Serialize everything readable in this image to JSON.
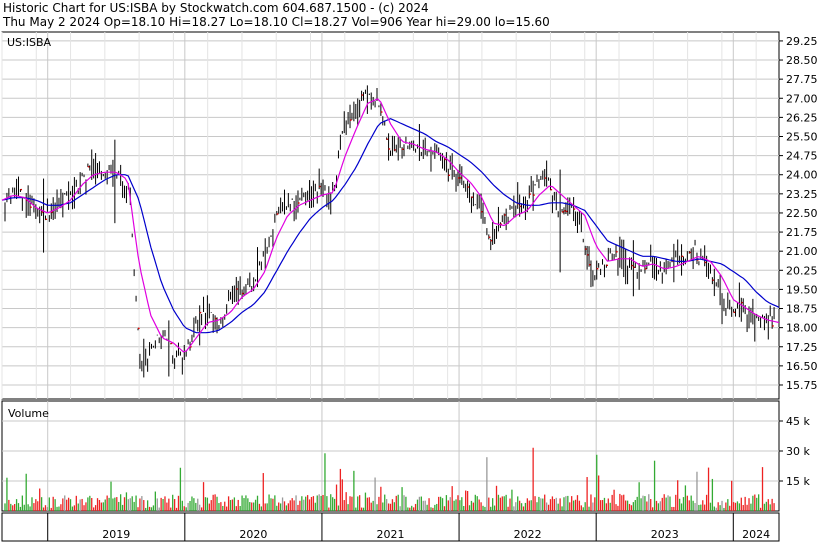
{
  "header": {
    "title_line": "Historic Chart for US:ISBA by Stockwatch.com 604.687.1500 - (c) 2024",
    "stats_line": "Thu May  2 2024  Op=18.10  Hi=18.27  Lo=18.10  Cl=18.27  Vol=906  Year hi=29.00  lo=15.60"
  },
  "colors": {
    "price_bar": "#000000",
    "down_tick": "#dd0000",
    "ma_short": "#e000e0",
    "ma_long": "#0000cc",
    "vol_up": "#33aa33",
    "vol_down": "#ee2222",
    "vol_neutral": "#999999",
    "grid": "#c8c8c8"
  },
  "chart_data": [
    {
      "type": "line",
      "symbol_label": "US:ISBA",
      "ylim": [
        15.2,
        29.6
      ],
      "y_ticks": [
        "29.25",
        "28.50",
        "27.75",
        "27.00",
        "26.25",
        "25.50",
        "24.75",
        "24.00",
        "23.25",
        "22.50",
        "21.75",
        "21.00",
        "20.25",
        "19.50",
        "18.75",
        "18.00",
        "17.25",
        "16.50",
        "15.75"
      ],
      "x_ticks": [
        "2019",
        "2020",
        "2021",
        "2022",
        "2023",
        "2024"
      ],
      "x_range": [
        "2018-09",
        "2024-05"
      ],
      "series": [
        {
          "kind": "close",
          "x": [
            "2018-09",
            "2018-10",
            "2018-11",
            "2018-12",
            "2019-01",
            "2019-02",
            "2019-03",
            "2019-04",
            "2019-05",
            "2019-06",
            "2019-07",
            "2019-08",
            "2019-09",
            "2019-10",
            "2019-11",
            "2019-12",
            "2020-01",
            "2020-02",
            "2020-03",
            "2020-04",
            "2020-05",
            "2020-06",
            "2020-07",
            "2020-08",
            "2020-09",
            "2020-10",
            "2020-11",
            "2020-12",
            "2021-01",
            "2021-02",
            "2021-03",
            "2021-04",
            "2021-05",
            "2021-06",
            "2021-07",
            "2021-08",
            "2021-09",
            "2021-10",
            "2021-11",
            "2021-12",
            "2022-01",
            "2022-02",
            "2022-03",
            "2022-04",
            "2022-05",
            "2022-06",
            "2022-07",
            "2022-08",
            "2022-09",
            "2022-10",
            "2022-11",
            "2022-12",
            "2023-01",
            "2023-02",
            "2023-03",
            "2023-04",
            "2023-05",
            "2023-06",
            "2023-07",
            "2023-08",
            "2023-09",
            "2023-10",
            "2023-11",
            "2023-12",
            "2024-01",
            "2024-02",
            "2024-03",
            "2024-04",
            "2024-05"
          ],
          "values": [
            23.0,
            23.3,
            23.1,
            22.4,
            22.5,
            22.9,
            23.3,
            24.0,
            24.2,
            24.1,
            24.0,
            23.4,
            16.4,
            17.4,
            17.9,
            16.8,
            16.9,
            18.5,
            18.7,
            17.9,
            19.3,
            19.4,
            19.7,
            21.0,
            22.4,
            22.8,
            23.0,
            23.2,
            23.4,
            23.2,
            26.0,
            26.5,
            27.3,
            26.8,
            25.1,
            25.0,
            25.3,
            24.8,
            24.9,
            24.3,
            23.8,
            23.4,
            22.8,
            21.3,
            22.3,
            22.6,
            22.7,
            23.6,
            24.0,
            22.4,
            23.0,
            21.9,
            20.0,
            20.4,
            21.0,
            20.5,
            20.2,
            20.7,
            20.0,
            20.8,
            20.6,
            21.0,
            20.4,
            19.5,
            18.6,
            18.9,
            18.3,
            18.2,
            18.27
          ]
        },
        {
          "kind": "ma_short",
          "values": [
            23.0,
            23.2,
            23.1,
            22.7,
            22.5,
            22.7,
            23.0,
            23.6,
            24.0,
            24.1,
            24.1,
            23.8,
            20.5,
            18.5,
            17.6,
            17.4,
            17.0,
            17.6,
            18.2,
            18.3,
            18.6,
            19.2,
            19.5,
            20.2,
            21.5,
            22.4,
            22.8,
            23.0,
            23.2,
            23.3,
            24.7,
            25.8,
            26.8,
            27.0,
            26.0,
            25.3,
            25.2,
            25.0,
            24.9,
            24.6,
            24.1,
            23.7,
            23.1,
            22.1,
            22.0,
            22.4,
            22.6,
            23.2,
            23.6,
            23.2,
            22.8,
            22.4,
            21.2,
            20.6,
            20.7,
            20.7,
            20.4,
            20.5,
            20.3,
            20.4,
            20.6,
            20.8,
            20.6,
            20.0,
            19.1,
            18.8,
            18.5,
            18.3,
            18.2
          ]
        },
        {
          "kind": "ma_long",
          "values": [
            23.0,
            23.1,
            23.1,
            23.0,
            22.8,
            22.8,
            22.9,
            23.2,
            23.5,
            23.8,
            24.0,
            24.0,
            23.0,
            21.2,
            19.7,
            18.7,
            18.0,
            17.8,
            17.8,
            17.9,
            18.2,
            18.6,
            18.9,
            19.4,
            20.2,
            21.0,
            21.7,
            22.3,
            22.7,
            23.0,
            23.6,
            24.3,
            25.2,
            26.0,
            26.2,
            26.0,
            25.8,
            25.6,
            25.3,
            25.1,
            24.8,
            24.5,
            24.1,
            23.6,
            23.2,
            22.9,
            22.8,
            22.8,
            22.9,
            22.9,
            22.8,
            22.6,
            22.0,
            21.4,
            21.2,
            21.0,
            20.8,
            20.8,
            20.7,
            20.6,
            20.6,
            20.7,
            20.6,
            20.5,
            20.2,
            19.9,
            19.4,
            19.0,
            18.8
          ]
        }
      ]
    },
    {
      "type": "bar",
      "title": "Volume",
      "y_ticks": [
        "45 k",
        "30 k",
        "15 k"
      ],
      "ylim": [
        0,
        55000
      ]
    }
  ]
}
